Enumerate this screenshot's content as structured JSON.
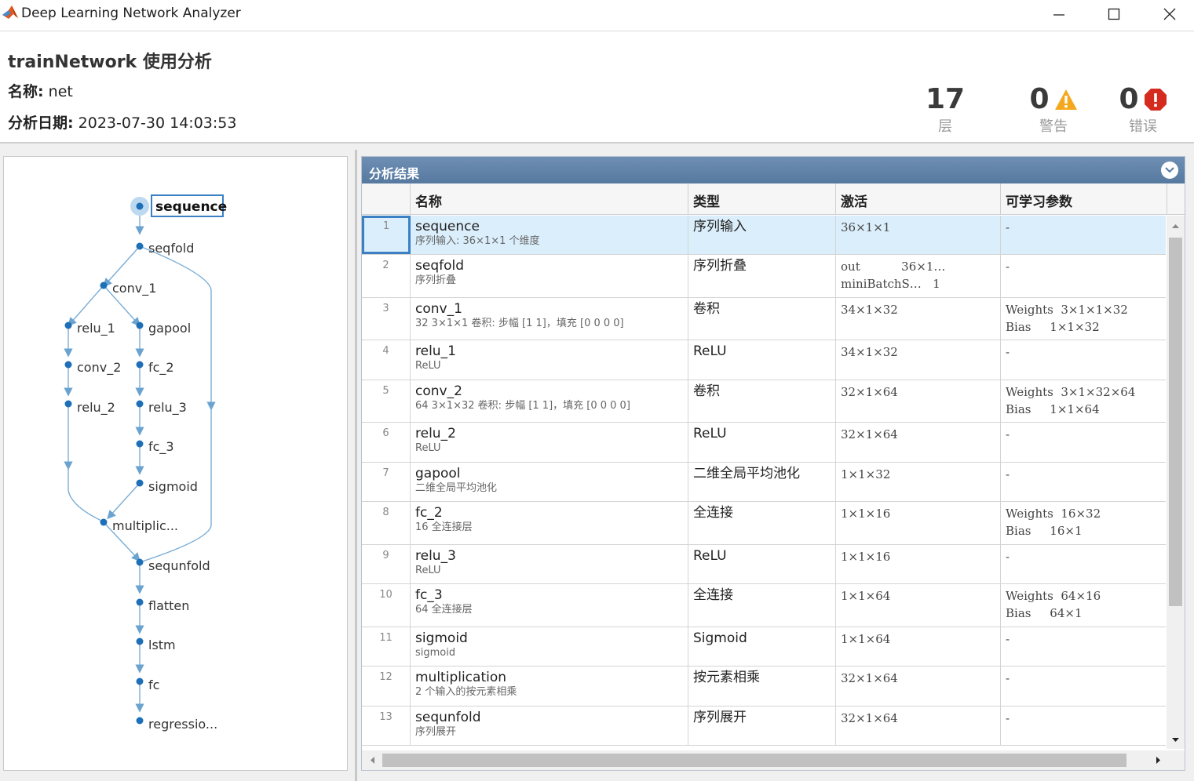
{
  "window": {
    "title": "Deep Learning Network Analyzer",
    "icon": "matlab-icon"
  },
  "header": {
    "title": "trainNetwork 使用分析",
    "name_label": "名称:",
    "name_value": "net",
    "date_label": "分析日期:",
    "date_value": "2023-07-30 14:03:53"
  },
  "stats": {
    "layers": {
      "value": "17",
      "label": "层"
    },
    "warnings": {
      "value": "0",
      "label": "警告",
      "icon": "warning-icon",
      "color": "#f4a81d"
    },
    "errors": {
      "value": "0",
      "label": "错误",
      "icon": "error-icon",
      "color": "#d52b1e"
    }
  },
  "graph": {
    "nodes": [
      "sequence",
      "seqfold",
      "conv_1",
      "relu_1",
      "gapool",
      "conv_2",
      "fc_2",
      "relu_2",
      "relu_3",
      "fc_3",
      "sigmoid",
      "multiplic...",
      "sequnfold",
      "flatten",
      "lstm",
      "fc",
      "regressio..."
    ],
    "selected": "sequence"
  },
  "results": {
    "title": "分析结果",
    "columns": [
      "名称",
      "类型",
      "激活",
      "可学习参数"
    ],
    "rows": [
      {
        "index": "1",
        "name": "sequence",
        "desc": "序列输入: 36×1×1 个维度",
        "type": "序列输入",
        "act": "36×1×1",
        "params": "-"
      },
      {
        "index": "2",
        "name": "seqfold",
        "desc": "序列折叠",
        "type": "序列折叠",
        "act": "out           36×1…\nminiBatchS…   1",
        "params": "-"
      },
      {
        "index": "3",
        "name": "conv_1",
        "desc": "32 3×1×1 卷积: 步幅 [1  1]，填充 [0  0  0  0]",
        "type": "卷积",
        "act": "34×1×32",
        "params": "Weights  3×1×1×32\nBias     1×1×32"
      },
      {
        "index": "4",
        "name": "relu_1",
        "desc": "ReLU",
        "type": "ReLU",
        "act": "34×1×32",
        "params": "-"
      },
      {
        "index": "5",
        "name": "conv_2",
        "desc": "64 3×1×32 卷积: 步幅 [1  1]，填充 [0  0  0  0]",
        "type": "卷积",
        "act": "32×1×64",
        "params": "Weights  3×1×32×64\nBias     1×1×64"
      },
      {
        "index": "6",
        "name": "relu_2",
        "desc": "ReLU",
        "type": "ReLU",
        "act": "32×1×64",
        "params": "-"
      },
      {
        "index": "7",
        "name": "gapool",
        "desc": "二维全局平均池化",
        "type": "二维全局平均池化",
        "act": "1×1×32",
        "params": "-"
      },
      {
        "index": "8",
        "name": "fc_2",
        "desc": "16 全连接层",
        "type": "全连接",
        "act": "1×1×16",
        "params": "Weights  16×32\nBias     16×1"
      },
      {
        "index": "9",
        "name": "relu_3",
        "desc": "ReLU",
        "type": "ReLU",
        "act": "1×1×16",
        "params": "-"
      },
      {
        "index": "10",
        "name": "fc_3",
        "desc": "64 全连接层",
        "type": "全连接",
        "act": "1×1×64",
        "params": "Weights  64×16\nBias     64×1"
      },
      {
        "index": "11",
        "name": "sigmoid",
        "desc": "sigmoid",
        "type": "Sigmoid",
        "act": "1×1×64",
        "params": "-"
      },
      {
        "index": "12",
        "name": "multiplication",
        "desc": "2 个输入的按元素相乘",
        "type": "按元素相乘",
        "act": "32×1×64",
        "params": "-"
      },
      {
        "index": "13",
        "name": "sequnfold",
        "desc": "序列展开",
        "type": "序列展开",
        "act": "32×1×64",
        "params": "-"
      }
    ]
  }
}
